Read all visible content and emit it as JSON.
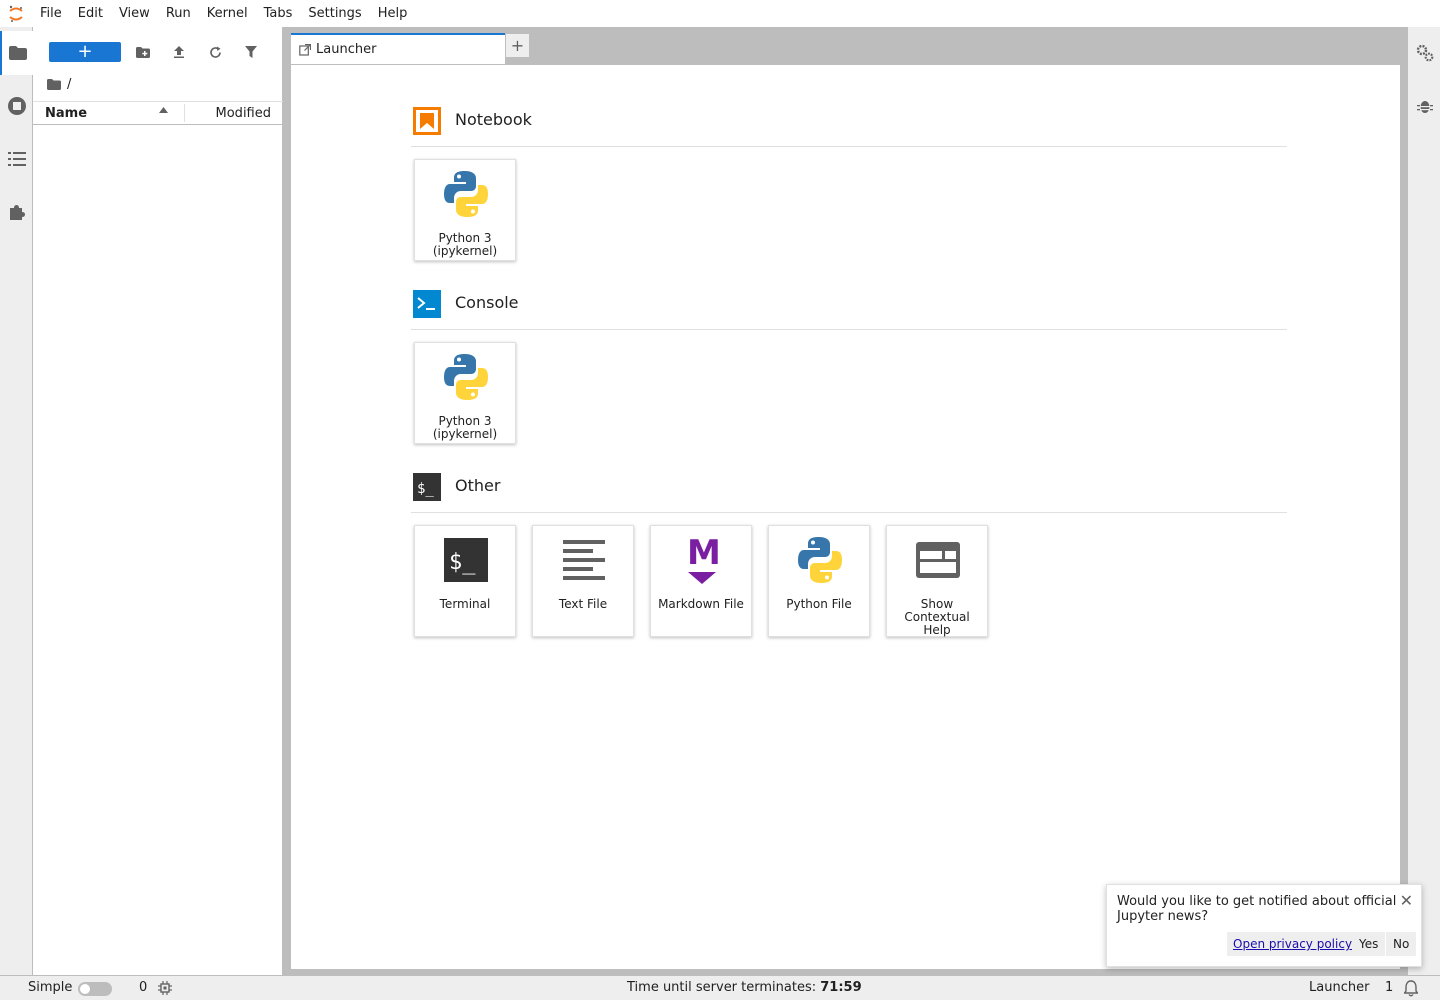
{
  "menubar": {
    "items": [
      "File",
      "Edit",
      "View",
      "Run",
      "Kernel",
      "Tabs",
      "Settings",
      "Help"
    ]
  },
  "filebrowser": {
    "new_label": "+",
    "breadcrumb": "/",
    "columns": {
      "name": "Name",
      "modified": "Modified"
    }
  },
  "tabs": [
    {
      "label": "Launcher"
    }
  ],
  "tab_add_label": "+",
  "launcher": {
    "sections": [
      {
        "title": "Notebook",
        "items": [
          {
            "label": "Python 3 (ipykernel)"
          }
        ]
      },
      {
        "title": "Console",
        "items": [
          {
            "label": "Python 3 (ipykernel)"
          }
        ]
      },
      {
        "title": "Other",
        "items": [
          {
            "label": "Terminal"
          },
          {
            "label": "Text File"
          },
          {
            "label": "Markdown File"
          },
          {
            "label": "Python File"
          },
          {
            "label": "Show Contextual Help"
          }
        ]
      }
    ]
  },
  "statusbar": {
    "mode_label": "Simple",
    "kernel_count": "0",
    "timer_prefix": "Time until server terminates:",
    "timer_value": "71:59",
    "active_tab": "Launcher",
    "notification_count": "1"
  },
  "toast": {
    "message": "Would you like to get notified about official Jupyter news?",
    "privacy_link": "Open privacy policy",
    "yes": "Yes",
    "no": "No",
    "close": "✕"
  },
  "colors": {
    "accent": "#1976d2",
    "notebook_icon": "#f57c00",
    "console_icon": "#0288d1",
    "other_icon": "#333333",
    "markdown": "#7b1fa2"
  }
}
